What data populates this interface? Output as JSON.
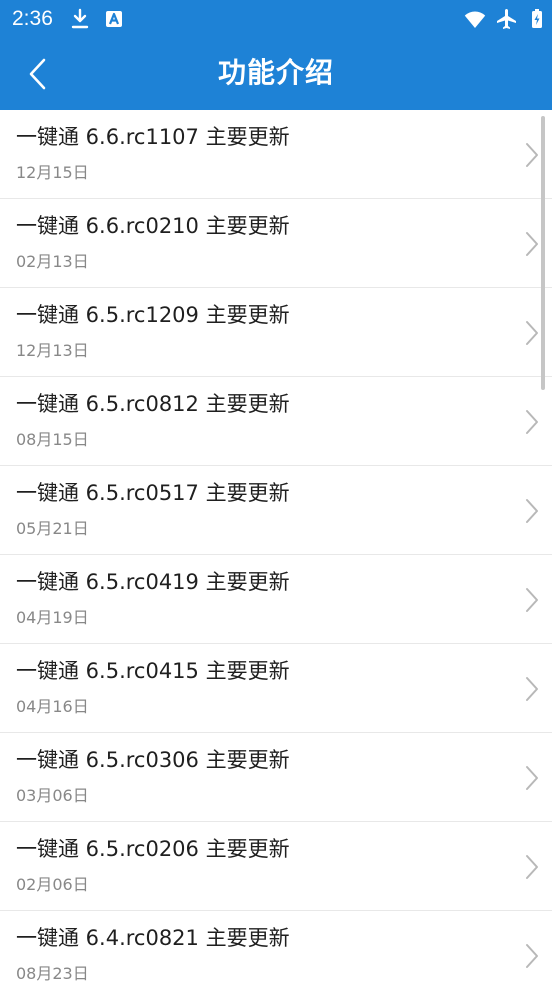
{
  "status_bar": {
    "time": "2:36",
    "icons": [
      "download-icon",
      "keyboard-a-icon",
      "wifi-icon",
      "airplane-icon",
      "battery-charging-icon"
    ]
  },
  "app_bar": {
    "back_icon": "chevron-left-icon",
    "title": "功能介绍"
  },
  "colors": {
    "accent": "#1e82d6",
    "title_text": "#ffffff",
    "item_title": "#1f1f1f",
    "item_date": "#888888",
    "divider": "#e8e8e8",
    "chevron": "#b8b8b8"
  },
  "updates": [
    {
      "title": "一键通 6.6.rc1107 主要更新",
      "date": "12月15日"
    },
    {
      "title": "一键通 6.6.rc0210 主要更新",
      "date": "02月13日"
    },
    {
      "title": "一键通 6.5.rc1209 主要更新",
      "date": "12月13日"
    },
    {
      "title": "一键通 6.5.rc0812 主要更新",
      "date": "08月15日"
    },
    {
      "title": "一键通 6.5.rc0517 主要更新",
      "date": "05月21日"
    },
    {
      "title": "一键通 6.5.rc0419 主要更新",
      "date": "04月19日"
    },
    {
      "title": "一键通 6.5.rc0415 主要更新",
      "date": "04月16日"
    },
    {
      "title": "一键通 6.5.rc0306 主要更新",
      "date": "03月06日"
    },
    {
      "title": "一键通 6.5.rc0206 主要更新",
      "date": "02月06日"
    },
    {
      "title": "一键通 6.4.rc0821 主要更新",
      "date": "08月23日"
    }
  ]
}
